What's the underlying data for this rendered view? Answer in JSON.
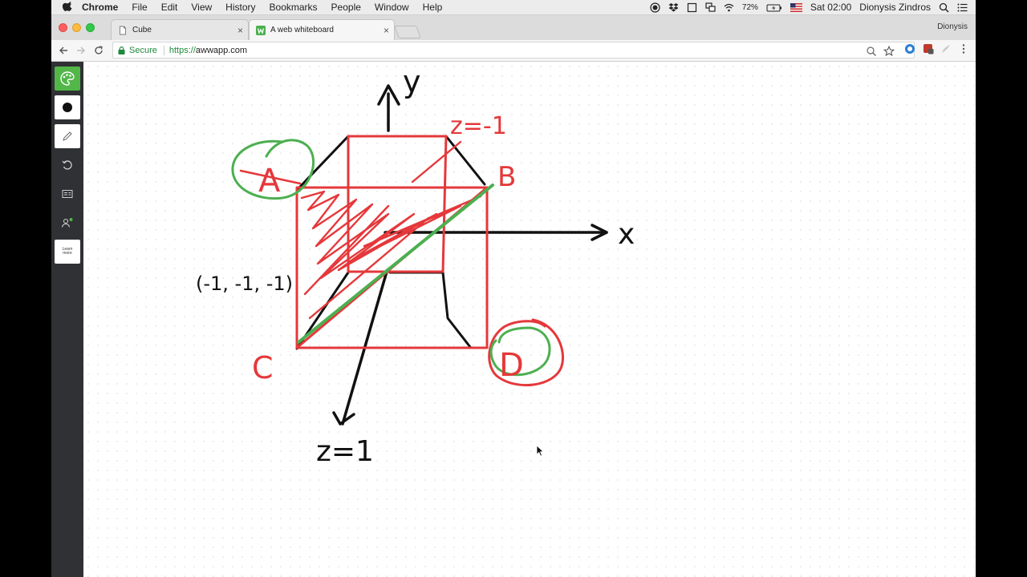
{
  "menubar": {
    "apple_icon": "apple-icon",
    "items": [
      "Chrome",
      "File",
      "Edit",
      "View",
      "History",
      "Bookmarks",
      "People",
      "Window",
      "Help"
    ],
    "battery": "72%",
    "clock": "Sat 02:00",
    "user": "Dionysis Zindros"
  },
  "tabs": [
    {
      "title": "Cube",
      "active": false
    },
    {
      "title": "A web whiteboard",
      "active": true
    }
  ],
  "profile_name": "Dionysis",
  "address_bar": {
    "security_label": "Secure",
    "scheme": "https://",
    "host": "awwapp.com"
  },
  "sidebar": {
    "learn_more_label": "Learn more"
  },
  "whiteboard": {
    "labels": {
      "y_axis": "y",
      "x_axis": "x",
      "z_top": "z=-1",
      "z_bottom": "z=1",
      "point_a": "A",
      "point_b": "B",
      "point_c": "C",
      "point_d": "D",
      "coordinate": "(-1, -1, -1)"
    },
    "colors": {
      "ink_black": "#111111",
      "ink_red": "#e5383b",
      "ink_green": "#4caf50"
    }
  }
}
